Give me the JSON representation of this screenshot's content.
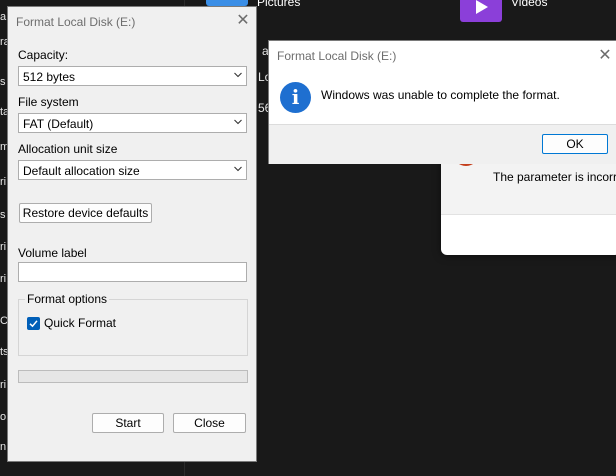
{
  "background": {
    "pictures_label": "Pictures",
    "videos_label": "Videos",
    "left_fragments": [
      "a",
      "ra",
      "s",
      "ta",
      "m",
      "ri",
      "s",
      "ri",
      "ri",
      "C",
      "o",
      "ts",
      "ri",
      "n"
    ],
    "frag_a": "a",
    "frag_lo": "Lo",
    "frag_56": "56",
    "error_text": "The parameter is incorre"
  },
  "format_dialog": {
    "title": "Format Local Disk (E:)",
    "capacity_label": "Capacity:",
    "capacity_value": "512 bytes",
    "filesystem_label": "File system",
    "filesystem_value": "FAT (Default)",
    "allocation_label": "Allocation unit size",
    "allocation_value": "Default allocation size",
    "restore_button": "Restore device defaults",
    "volume_label": "Volume label",
    "volume_value": "",
    "format_options_label": "Format options",
    "quick_format_label": "Quick Format",
    "quick_format_checked": true,
    "start_button": "Start",
    "close_button": "Close"
  },
  "message_box": {
    "title": "Format Local Disk (E:)",
    "message": "Windows was unable to complete the format.",
    "ok_button": "OK"
  },
  "colors": {
    "info_icon": "#1e6fd0",
    "checkbox": "#005fb8",
    "pictures_icon": "#3a8ee6",
    "videos_icon": "#8b3fd9",
    "error_icon": "#c43e1c"
  }
}
